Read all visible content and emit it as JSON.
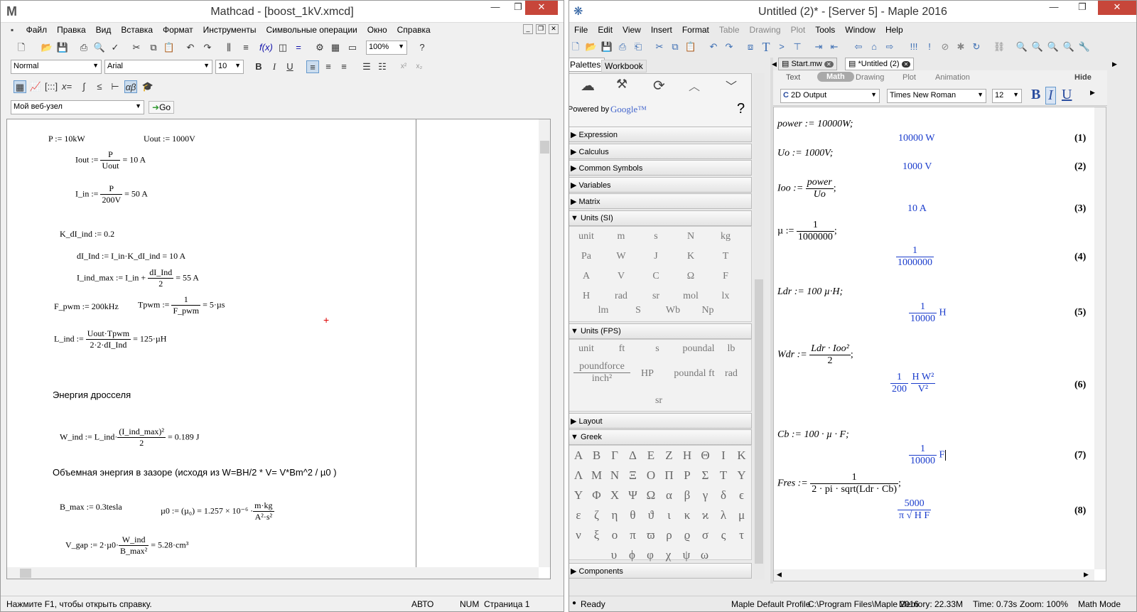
{
  "mathcad": {
    "title": "Mathcad - [boost_1kV.xmcd]",
    "menu": [
      "Файл",
      "Правка",
      "Вид",
      "Вставка",
      "Формат",
      "Инструменты",
      "Символьные операции",
      "Окно",
      "Справка"
    ],
    "style_select": "Normal",
    "font_select": "Arial",
    "size_select": "10",
    "zoom_select": "100%",
    "url_select": "Мой веб-узел",
    "go_label": "Go",
    "lines": {
      "p": "P := 10kW",
      "uout": "Uout := 1000V",
      "iout_l": "Iout :=",
      "iout_n": "P",
      "iout_d": "Uout",
      "iout_r": "= 10 A",
      "iin_l": "I_in :=",
      "iin_n": "P",
      "iin_d": "200V",
      "iin_r": "= 50 A",
      "kdi": "K_dI_ind := 0.2",
      "dii": "dI_Ind := I_in·K_dI_ind = 10 A",
      "imax_l": "I_ind_max := I_in +",
      "imax_n": "dI_Ind",
      "imax_d": "2",
      "imax_r": "= 55 A",
      "fpwm": "F_pwm := 200kHz",
      "tpwm_l": "Tpwm :=",
      "tpwm_n": "1",
      "tpwm_d": "F_pwm",
      "tpwm_r": "= 5·µs",
      "lind_l": "L_ind :=",
      "lind_n": "Uout·Tpwm",
      "lind_d": "2·2·dI_Ind",
      "lind_r": "= 125·µH",
      "energy_text": "Энергия дросселя",
      "wind_l": "W_ind := L_ind·",
      "wind_n": "(I_ind_max)²",
      "wind_d": "2",
      "wind_r": "= 0.189 J",
      "volume_text": "Объемная энергия в зазоре (исходя из W=BH/2 * V= V*Bm^2 / µ0 )",
      "bmax": "B_max := 0.3tesla",
      "mu0_l": "µ0 := (µ₀) = 1.257 × 10⁻⁶ ·",
      "mu0_n": "m·kg",
      "mu0_d": "A²·s²",
      "vgap_l": "V_gap := 2·µ0·",
      "vgap_n": "W_ind",
      "vgap_d": "B_max²",
      "vgap_r": "= 5.28·cm³"
    },
    "status": {
      "help": "Нажмите F1, чтобы открыть справку.",
      "auto": "АВТО",
      "num": "NUM",
      "page": "Страница 1"
    }
  },
  "maple": {
    "title": "Untitled (2)* - [Server 5] - Maple 2016",
    "menu": [
      "File",
      "Edit",
      "View",
      "Insert",
      "Format",
      "Table",
      "Drawing",
      "Plot",
      "Tools",
      "Window",
      "Help"
    ],
    "palette_tabs": [
      "Palettes",
      "Workbook"
    ],
    "powered_by": "Powered by",
    "google": "Google™",
    "help_q": "?",
    "sections": {
      "expression": "Expression",
      "calculus": "Calculus",
      "common": "Common Symbols",
      "variables": "Variables",
      "matrix": "Matrix",
      "units_si": "Units (SI)",
      "units_fps": "Units (FPS)",
      "layout": "Layout",
      "greek": "Greek",
      "components": "Components"
    },
    "units_si": [
      "unit",
      "m",
      "s",
      "N",
      "kg",
      "Pa",
      "W",
      "J",
      "K",
      "T",
      "A",
      "V",
      "C",
      "Ω",
      "F",
      "H",
      "rad",
      "sr",
      "mol",
      "lx",
      "lm",
      "S",
      "Wb",
      "Np"
    ],
    "units_fps": [
      "unit",
      "ft",
      "s",
      "poundal",
      "lb",
      "poundforce",
      "inch²",
      "HP",
      "poundal ft",
      "rad",
      "sr"
    ],
    "greek": [
      "Α",
      "Β",
      "Γ",
      "Δ",
      "Ε",
      "Ζ",
      "Η",
      "Θ",
      "Ι",
      "Κ",
      "Λ",
      "Μ",
      "Ν",
      "Ξ",
      "Ο",
      "Π",
      "Ρ",
      "Σ",
      "Τ",
      "Υ",
      "Υ",
      "Φ",
      "Χ",
      "Ψ",
      "Ω",
      "α",
      "β",
      "γ",
      "δ",
      "ϵ",
      "ε",
      "ζ",
      "η",
      "θ",
      "ϑ",
      "ι",
      "κ",
      "ϰ",
      "λ",
      "μ",
      "ν",
      "ξ",
      "ο",
      "π",
      "ϖ",
      "ρ",
      "ϱ",
      "σ",
      "ς",
      "τ",
      "υ",
      "ϕ",
      "φ",
      "χ",
      "ψ",
      "ω"
    ],
    "doc_tabs": [
      "Start.mw",
      "*Untitled (2)"
    ],
    "mode_tabs": [
      "Text",
      "Math",
      "Drawing",
      "Plot",
      "Animation"
    ],
    "hide": "Hide",
    "output_select": "2D Output",
    "font_select": "Times New Roman",
    "size_select": "12",
    "fmt": [
      "B",
      "I",
      "U"
    ],
    "worksheet": {
      "power_in": "power := 10000W;",
      "power_out": "10000 W",
      "n1": "(1)",
      "uo_in": "Uo := 1000V;",
      "uo_out": "1000 V",
      "n2": "(2)",
      "ioo_l": "Ioo :=",
      "ioo_n": "power",
      "ioo_d": "Uo",
      "ioo_r": ";",
      "ioo_out": "10 A",
      "n3": "(3)",
      "mu_l": "µ :=",
      "mu_n": "1",
      "mu_d": "1000000",
      "mu_r": ";",
      "mu_on": "1",
      "mu_od": "1000000",
      "n4": "(4)",
      "ldr_in": "Ldr := 100 µ·H;",
      "ldr_on": "1",
      "ldr_od": "10000",
      "ldr_u": "H",
      "n5": "(5)",
      "wdr_l": "Wdr :=",
      "wdr_n": "Ldr · Ioo²",
      "wdr_d": "2",
      "wdr_r": ";",
      "wdr_on": "1",
      "wdr_od": "200",
      "wdr_un": "H W²",
      "wdr_ud": "V²",
      "n6": "(6)",
      "cb_in": "Cb := 100 · µ · F;",
      "cb_on": "1",
      "cb_od": "10000",
      "cb_u": "F",
      "n7": "(7)",
      "fres_l": "Fres :=",
      "fres_n": "1",
      "fres_d": "2 · pi · sqrt(Ldr · Cb)",
      "fres_r": ";",
      "fres_on": "5000",
      "fres_od": "π √ H F",
      "n8": "(8)"
    },
    "status": {
      "ready": "Ready",
      "profile": "Maple Default Profile",
      "path": "C:\\Program Files\\Maple 2016",
      "memory": "Memory: 22.33M",
      "time": "Time: 0.73s",
      "zoom": "Zoom: 100%",
      "mode": "Math Mode"
    }
  }
}
